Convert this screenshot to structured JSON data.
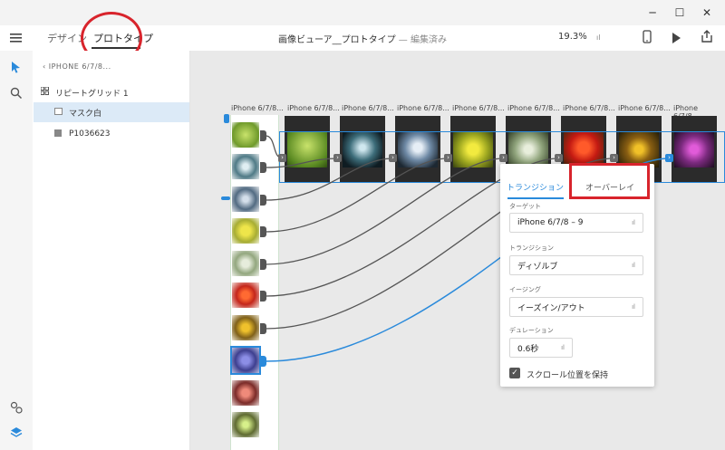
{
  "window": {
    "minimize": "─",
    "maximize": "☐",
    "close": "✕"
  },
  "header": {
    "tabs": [
      {
        "label": "デザイン"
      },
      {
        "label": "プロトタイプ"
      }
    ],
    "doc_title": "画像ビューア__プロトタイプ",
    "doc_separator": "—",
    "doc_status": "編集済み",
    "zoom": "19.3%"
  },
  "layers": {
    "breadcrumb": "IPHONE 6/7/8...",
    "items": [
      {
        "label": "リピートグリッド 1"
      },
      {
        "label": "マスク白"
      },
      {
        "label": "P1036623"
      }
    ]
  },
  "canvas": {
    "artboards": [
      {
        "label": "iPhone 6/7/8..."
      },
      {
        "label": "iPhone 6/7/8..."
      },
      {
        "label": "iPhone 6/7/8..."
      },
      {
        "label": "iPhone 6/7/8..."
      },
      {
        "label": "iPhone 6/7/8..."
      },
      {
        "label": "iPhone 6/7/8..."
      },
      {
        "label": "iPhone 6/7/8..."
      },
      {
        "label": "iPhone 6/7/8..."
      },
      {
        "label": "iPhone 6/7/8..."
      }
    ]
  },
  "popup": {
    "tabs": [
      {
        "label": "トランジション"
      },
      {
        "label": "オーバーレイ"
      }
    ],
    "target_label": "ターゲット",
    "target_value": "iPhone 6/7/8 – 9",
    "transition_label": "トランジション",
    "transition_value": "ディゾルブ",
    "easing_label": "イージング",
    "easing_value": "イーズイン/アウト",
    "duration_label": "デュレーション",
    "duration_value": "0.6秒",
    "checkbox_label": "スクロール位置を保持"
  }
}
